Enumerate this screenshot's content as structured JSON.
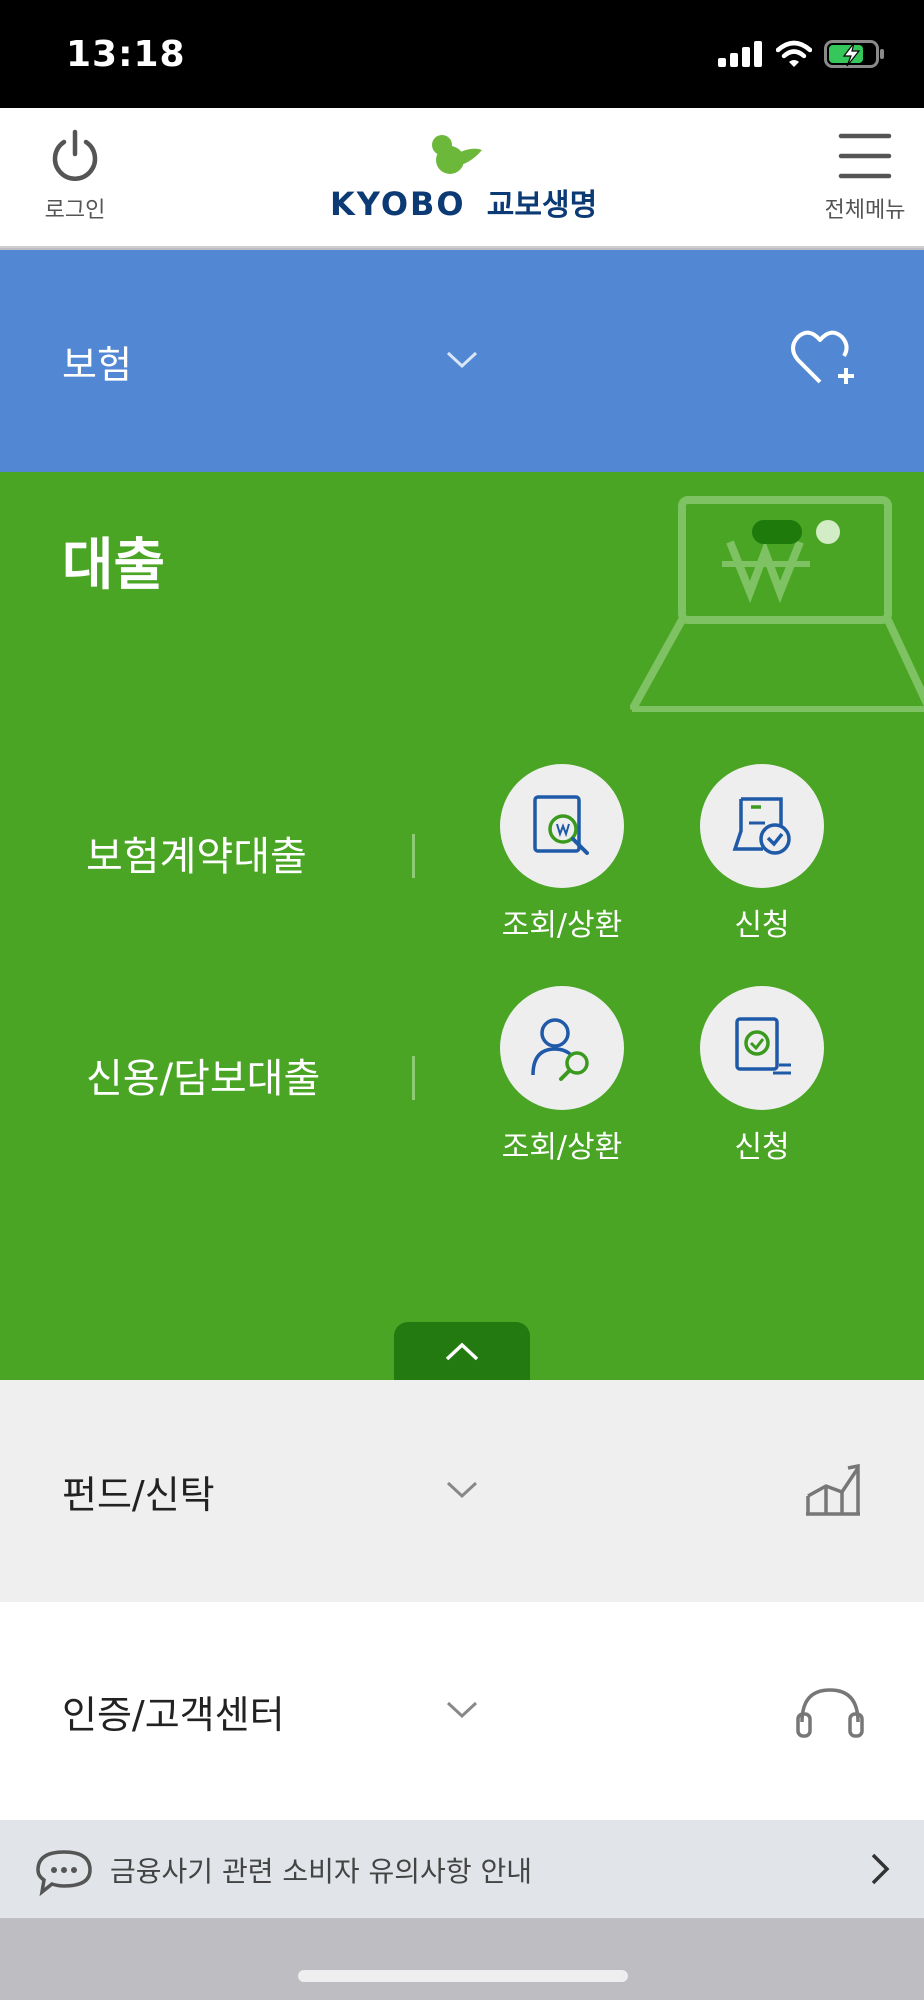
{
  "status_bar": {
    "time": "13:18"
  },
  "header": {
    "login_label": "로그인",
    "menu_label": "전체메뉴",
    "logo_en": "KYOBO",
    "logo_ko": "교보생명"
  },
  "sections": {
    "insurance": {
      "title": "보험"
    },
    "loan": {
      "title": "대출",
      "items": [
        {
          "label": "보험계약대출",
          "actions": [
            "조회/상환",
            "신청"
          ]
        },
        {
          "label": "신용/담보대출",
          "actions": [
            "조회/상환",
            "신청"
          ]
        }
      ]
    },
    "fund": {
      "title": "펀드/신탁"
    },
    "auth": {
      "title": "인증/고객센터"
    }
  },
  "notice": {
    "text": "금융사기 관련 소비자 유의사항 안내"
  },
  "colors": {
    "insurance_bg": "#5187d3",
    "loan_bg": "#4aa525",
    "fund_bg": "#efefef",
    "notice_bg": "#e1e4e8",
    "logo_blue": "#0c3a74",
    "logo_green": "#6bb83a"
  }
}
